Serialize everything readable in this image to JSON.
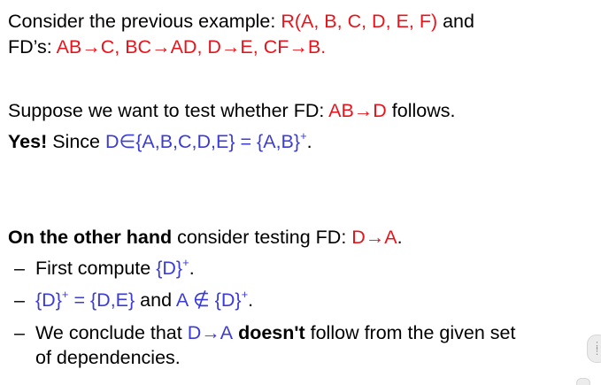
{
  "para1": {
    "line1_text": "Consider the previous example: ",
    "line1_relation": "R(A, B, C, D, E, F)",
    "line1_and": " and",
    "line2_text": "FD’s: ",
    "line2_fds": "AB→C,   BC→AD,   D→E,  CF→B."
  },
  "para2": {
    "line1_text": "Suppose we want to test whether FD: ",
    "line1_fd": "AB→D",
    "line1_end": " follows.",
    "line2_bold": "Yes!",
    "line2_text": " Since ",
    "line2_expr": "D∈{A,B,C,D,E} = {A,B}",
    "line2_sup": "+",
    "line2_end": "."
  },
  "para3": {
    "heading_bold": "On the other hand",
    "heading_text": " consider testing FD: ",
    "heading_fd": "D→A",
    "heading_end": ".",
    "bullets": [
      {
        "dash": "–",
        "text": "First compute ",
        "expr": "{D}",
        "sup": "+",
        "end": "."
      },
      {
        "dash": "–",
        "expr1": "{D}",
        "sup1": "+",
        "expr1b": " = {D,E}",
        "text": " and ",
        "expr2": "A ∉ {D}",
        "sup2": "+",
        "end": "."
      },
      {
        "dash": "–",
        "text": "We conclude that ",
        "fd": "D→A",
        "bold": " doesn't",
        "end": " follow from the given set",
        "cont": "of dependencies."
      }
    ]
  },
  "colors": {
    "red": "#e8141b",
    "blue": "#3b3bd6",
    "text": "#000000"
  },
  "icons": {
    "scroll_widget": "drag-handle-icon"
  }
}
